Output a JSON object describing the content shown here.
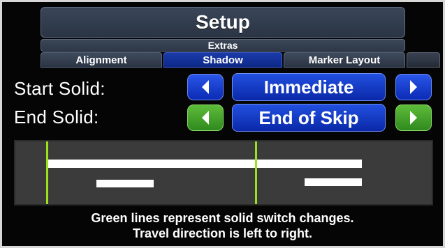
{
  "header": {
    "title": "Setup",
    "section": "Extras"
  },
  "tabs": [
    {
      "label": "Alignment",
      "active": false
    },
    {
      "label": "Shadow",
      "active": true
    },
    {
      "label": "Marker Layout",
      "active": false
    },
    {
      "label": "",
      "active": false
    }
  ],
  "settings": {
    "start_solid": {
      "label": "Start Solid:",
      "value": "Immediate",
      "prev_icon": "left-arrow-icon",
      "next_icon": "right-arrow-icon",
      "button_color": "#1a3fd0"
    },
    "end_solid": {
      "label": "End Solid:",
      "value": "End of Skip",
      "prev_icon": "left-arrow-icon",
      "next_icon": "right-arrow-icon",
      "button_color": "#47a82c"
    }
  },
  "diagram": {
    "background_color": "#3b3b3b",
    "line_color": "#ffffff",
    "switch_line_color": "#9be21b"
  },
  "caption": {
    "line1": "Green lines represent solid switch changes.",
    "line2": "Travel direction is left to right."
  }
}
